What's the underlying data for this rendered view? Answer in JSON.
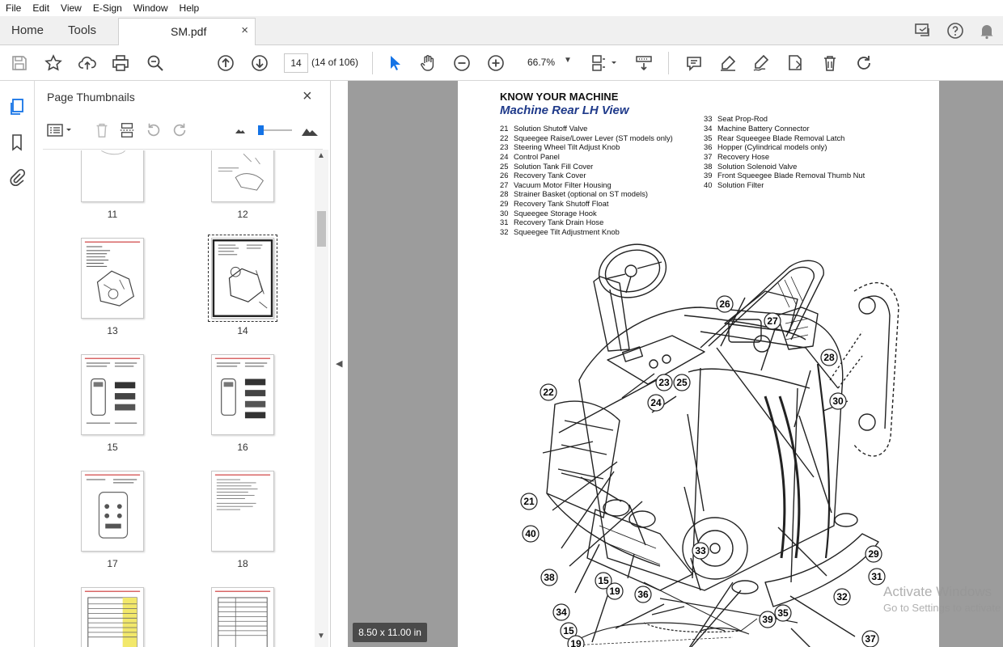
{
  "menu": [
    "File",
    "Edit",
    "View",
    "E-Sign",
    "Window",
    "Help"
  ],
  "tabs": {
    "home": "Home",
    "tools": "Tools",
    "document": "SM.pdf",
    "close_glyph": "×"
  },
  "toolbar": {
    "current_page": "14",
    "page_count": "(14 of 106)",
    "zoom": "66.7%"
  },
  "thumbnails_panel": {
    "title": "Page Thumbnails",
    "close_glyph": "×",
    "pages": [
      {
        "label": "11"
      },
      {
        "label": "12"
      },
      {
        "label": "13"
      },
      {
        "label": "14",
        "selected": true
      },
      {
        "label": "15"
      },
      {
        "label": "16"
      },
      {
        "label": "17"
      },
      {
        "label": "18"
      },
      {
        "label": ""
      },
      {
        "label": ""
      }
    ]
  },
  "document": {
    "heading": "KNOW YOUR MACHINE",
    "subheading": "Machine Rear LH View",
    "legend_left": [
      {
        "num": "21",
        "text": "Solution Shutoff Valve"
      },
      {
        "num": "22",
        "text": "Squeegee Raise/Lower Lever (ST models only)"
      },
      {
        "num": "23",
        "text": "Steering Wheel Tilt Adjust Knob"
      },
      {
        "num": "24",
        "text": "Control Panel"
      },
      {
        "num": "25",
        "text": "Solution Tank Fill Cover"
      },
      {
        "num": "26",
        "text": "Recovery Tank Cover"
      },
      {
        "num": "27",
        "text": "Vacuum Motor Filter Housing"
      },
      {
        "num": "28",
        "text": "Strainer Basket (optional on ST models)"
      },
      {
        "num": "29",
        "text": "Recovery Tank Shutoff Float"
      },
      {
        "num": "30",
        "text": "Squeegee Storage Hook"
      },
      {
        "num": "31",
        "text": "Recovery Tank Drain Hose"
      },
      {
        "num": "32",
        "text": "Squeegee Tilt Adjustment Knob"
      }
    ],
    "legend_right": [
      {
        "num": "33",
        "text": "Seat Prop-Rod"
      },
      {
        "num": "34",
        "text": "Machine Battery Connector"
      },
      {
        "num": "35",
        "text": "Rear Squeegee Blade Removal Latch"
      },
      {
        "num": "36",
        "text": "Hopper (Cylindrical models only)"
      },
      {
        "num": "37",
        "text": "Recovery Hose"
      },
      {
        "num": "38",
        "text": "Solution Solenoid Valve"
      },
      {
        "num": "39",
        "text": "Front Squeegee Blade Removal Thumb Nut"
      },
      {
        "num": "40",
        "text": "Solution Filter"
      }
    ],
    "callouts": [
      "26",
      "27",
      "28",
      "30",
      "22",
      "23",
      "25",
      "24",
      "21",
      "40",
      "33",
      "29",
      "38",
      "31",
      "34",
      "15",
      "19",
      "37",
      "15",
      "19",
      "36",
      "32",
      "35",
      "39"
    ],
    "page_size": "8.50 x 11.00 in"
  },
  "watermark": {
    "line1": "Activate Windows",
    "line2": "Go to Settings to activate Windows."
  }
}
